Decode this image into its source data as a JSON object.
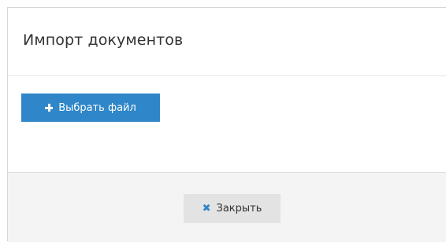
{
  "modal": {
    "title": "Импорт документов",
    "choose_file_label": "Выбрать файл",
    "close_label": "Закрыть",
    "close_icon_glyph": "✖",
    "icons": {
      "choose_file": "plus-icon",
      "close": "close-icon"
    },
    "colors": {
      "primary": "#2f86c8",
      "footer_bg": "#f4f4f4",
      "close_button_bg": "#e3e3e3"
    }
  }
}
